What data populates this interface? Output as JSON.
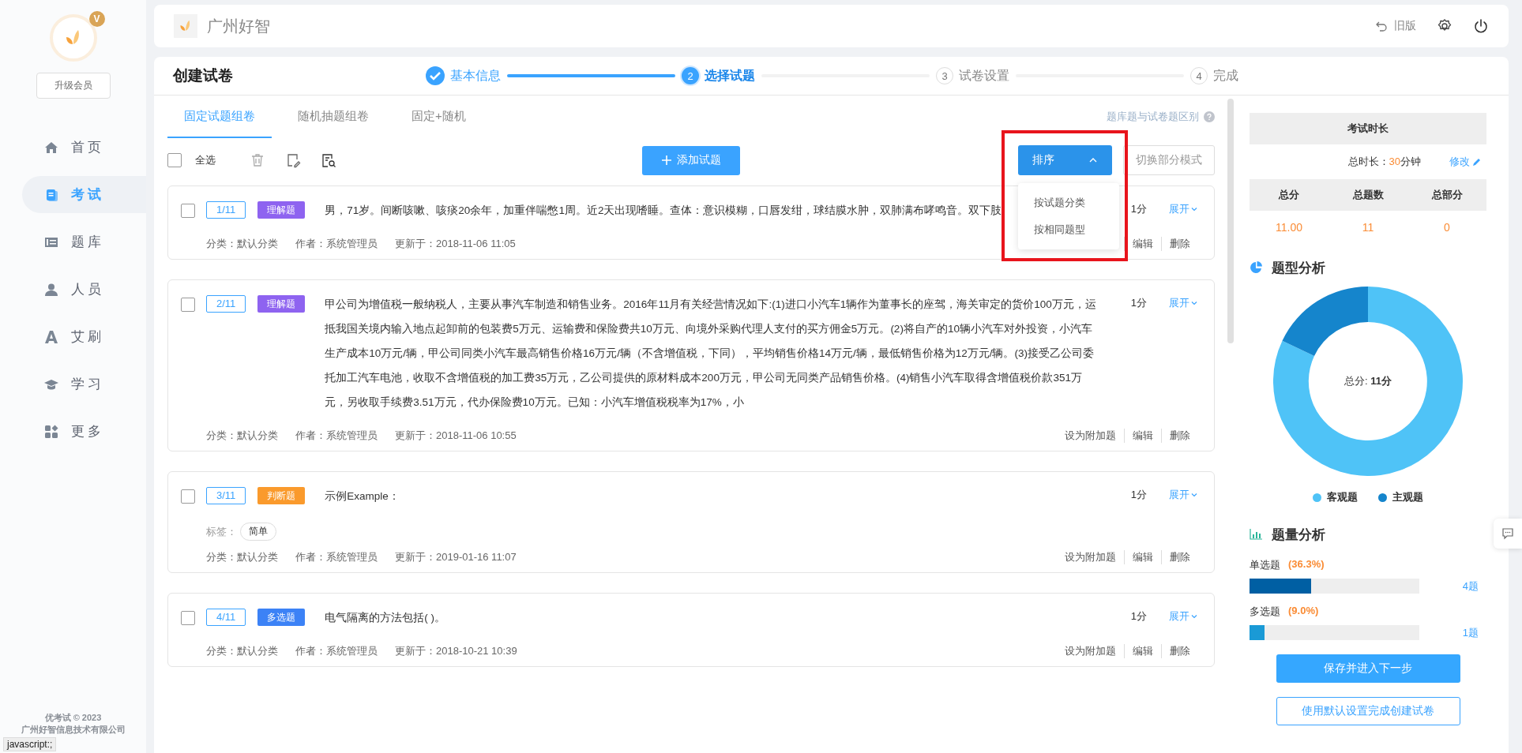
{
  "sidebar": {
    "badge": "V",
    "upgrade_button": "升级会员",
    "items": [
      {
        "label": "首页",
        "selected": false
      },
      {
        "label": "考试",
        "selected": true
      },
      {
        "label": "题库",
        "selected": false
      },
      {
        "label": "人员",
        "selected": false
      },
      {
        "label": "艾刷",
        "selected": false
      },
      {
        "label": "学习",
        "selected": false
      },
      {
        "label": "更多",
        "selected": false
      }
    ],
    "footer": [
      "优考试 © 2023",
      "广州好智信息技术有限公司"
    ]
  },
  "header": {
    "brand": "广州好智",
    "back_label": "旧版"
  },
  "page": {
    "title": "创建试卷",
    "steps": [
      {
        "label": "基本信息",
        "completed": true,
        "selected": false
      },
      {
        "number": "2",
        "label": "选择试题",
        "completed": false,
        "selected": true
      },
      {
        "number": "3",
        "label": "试卷设置",
        "completed": false,
        "selected": false
      },
      {
        "number": "4",
        "label": "完成",
        "completed": false,
        "selected": false
      }
    ]
  },
  "tabs": [
    {
      "label": "固定试题组卷",
      "selected": true
    },
    {
      "label": "随机抽题组卷",
      "selected": false
    },
    {
      "label": "固定+随机",
      "selected": false
    }
  ],
  "help_link": "题库题与试卷题区别",
  "toolbar": {
    "select_all": {
      "label": "全选",
      "checked": false
    },
    "add_button": "添加试题",
    "sort": {
      "label": "排序",
      "expanded": true,
      "highlighted": true,
      "options": [
        "按试题分类",
        "按相同题型"
      ]
    },
    "mode_button": "切换部分模式"
  },
  "questions": [
    {
      "index": "1/11",
      "type": "理解题",
      "color": "#8e63f0",
      "checked": false,
      "text": "男，71岁。间断咳嗽、咳痰20余年，加重伴喘憋1周。近2天出现嗜睡。查体：意识模糊，口唇发绀，球结膜水肿，双肺满布哮鸣音。双下肢",
      "meta": [
        {
          "label": "分类：",
          "value": "默认分类"
        },
        {
          "label": "作者：",
          "value": "系统管理员"
        },
        {
          "label": "更新于：",
          "value": "2018-11-06 11:05"
        }
      ],
      "score": "1分",
      "expand": "展开",
      "actions": [
        "编辑",
        "删除"
      ]
    },
    {
      "index": "2/11",
      "type": "理解题",
      "color": "#8e63f0",
      "checked": false,
      "text": "甲公司为增值税一般纳税人，主要从事汽车制造和销售业务。2016年11月有关经营情况如下:(1)进口小汽车1辆作为董事长的座驾，海关审定的货价100万元，运抵我国关境内输入地点起卸前的包装费5万元、运输费和保险费共10万元、向境外采购代理人支付的买方佣金5万元。(2)将自产的10辆小汽车对外投资，小汽车生产成本10万元/辆，甲公司同类小汽车最高销售价格16万元/辆（不含增值税，下同），平均销售价格14万元/辆，最低销售价格为12万元/辆。(3)接受乙公司委托加工汽车电池，收取不含增值税的加工费35万元，乙公司提供的原材料成本200万元，甲公司无同类产品销售价格。(4)销售小汽车取得含增值税价款351万元，另收取手续费3.51万元，代办保险费10万元。已知：小汽车增值税税率为17%，小",
      "meta": [
        {
          "label": "分类：",
          "value": "默认分类"
        },
        {
          "label": "作者：",
          "value": "系统管理员"
        },
        {
          "label": "更新于：",
          "value": "2018-11-06 10:55"
        }
      ],
      "score": "1分",
      "expand": "展开",
      "actions": [
        "设为附加题",
        "编辑",
        "删除"
      ]
    },
    {
      "index": "3/11",
      "type": "判断题",
      "color": "#fa9a2c",
      "checked": false,
      "text": "示例Example：",
      "tags_label": "标签：",
      "tags": [
        "简单"
      ],
      "meta": [
        {
          "label": "分类：",
          "value": "默认分类"
        },
        {
          "label": "作者：",
          "value": "系统管理员"
        },
        {
          "label": "更新于：",
          "value": "2019-01-16 11:07"
        }
      ],
      "score": "1分",
      "expand": "展开",
      "actions": [
        "设为附加题",
        "编辑",
        "删除"
      ]
    },
    {
      "index": "4/11",
      "type": "多选题",
      "color": "#3c82f6",
      "checked": false,
      "text": "电气隔离的方法包括( )。",
      "meta": [
        {
          "label": "分类：",
          "value": "默认分类"
        },
        {
          "label": "作者：",
          "value": "系统管理员"
        },
        {
          "label": "更新于：",
          "value": "2018-10-21 10:39"
        }
      ],
      "score": "1分",
      "expand": "展开",
      "actions": [
        "设为附加题",
        "编辑",
        "删除"
      ]
    }
  ],
  "summary": {
    "duration_title": "考试时长",
    "duration_label": "总时长：",
    "duration_value": "30",
    "duration_unit": "分钟",
    "edit_link": "修改",
    "stats": [
      {
        "label": "总分",
        "value": "11.00"
      },
      {
        "label": "总题数",
        "value": "11"
      },
      {
        "label": "总部分",
        "value": "0"
      }
    ]
  },
  "type_analysis": {
    "title": "题型分析",
    "center_label": "总分:",
    "center_value": "11分",
    "legend": [
      {
        "label": "客观题",
        "color": "#4fc3f7"
      },
      {
        "label": "主观题",
        "color": "#1585cc"
      }
    ]
  },
  "count_analysis": {
    "title": "题量分析",
    "items": [
      {
        "label": "单选题",
        "percent": "(36.3%)",
        "level": 0.363,
        "color": "#005fa3",
        "count": "4题"
      },
      {
        "label": "多选题",
        "percent": "(9.0%)",
        "level": 0.09,
        "color": "#1a9ad6",
        "count": "1题"
      }
    ]
  },
  "buttons": [
    {
      "label": "保存并进入下一步",
      "kind": "primary"
    },
    {
      "label": "使用默认设置完成创建试卷",
      "kind": "outline"
    }
  ],
  "status_bar": "javascript:;"
}
